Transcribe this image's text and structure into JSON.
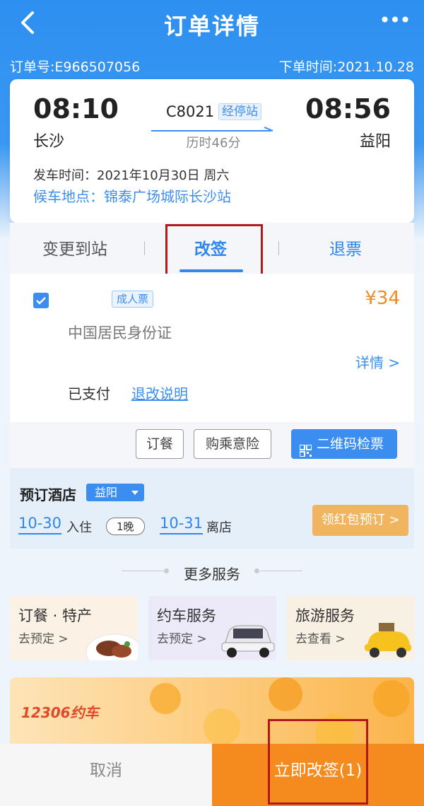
{
  "header": {
    "title": "订单详情",
    "order_no": "订单号:E966507056",
    "order_time": "下单时间:2021.10.28",
    "more": "•••"
  },
  "trip": {
    "dep_time": "08:10",
    "arr_time": "08:56",
    "dep_station": "长沙",
    "arr_station": "益阳",
    "train_no": "C8021",
    "stops_label": "经停站",
    "duration": "历时46分",
    "depart_datetime": "发车时间：2021年10月30日 周六",
    "waiting_place": "候车地点：锦泰广场城际长沙站"
  },
  "tabs": {
    "change_station": "变更到站",
    "reschedule": "改签",
    "refund": "退票"
  },
  "passenger": {
    "fare_type": "成人票",
    "price": "¥34",
    "id_type": "中国居民身份证",
    "detail_link": "详情 >",
    "status": "已支付",
    "rules_link": "退改说明",
    "actions": {
      "meal": "订餐",
      "insurance": "购乘意险",
      "qr_ticket": "二维码检票"
    }
  },
  "hotel": {
    "title": "预订酒店",
    "city": "益阳",
    "checkin_date": "10-30",
    "checkin_label": "入住",
    "nights": "1晚",
    "checkout_date": "10-31",
    "checkout_label": "离店",
    "book_button": "领红包预订 >"
  },
  "more_services": {
    "title": "更多服务",
    "items": [
      {
        "title": "订餐 · 特产",
        "sub": "去预定 >"
      },
      {
        "title": "约车服务",
        "sub": "去预定 >"
      },
      {
        "title": "旅游服务",
        "sub": "去查看 >"
      }
    ]
  },
  "banner": {
    "text": "12306约车"
  },
  "bottom": {
    "cancel": "取消",
    "confirm": "立即改签(1)"
  },
  "colors": {
    "primary_blue": "#2e86ee",
    "orange": "#f58a1f",
    "highlight_red": "#b01a1a"
  }
}
